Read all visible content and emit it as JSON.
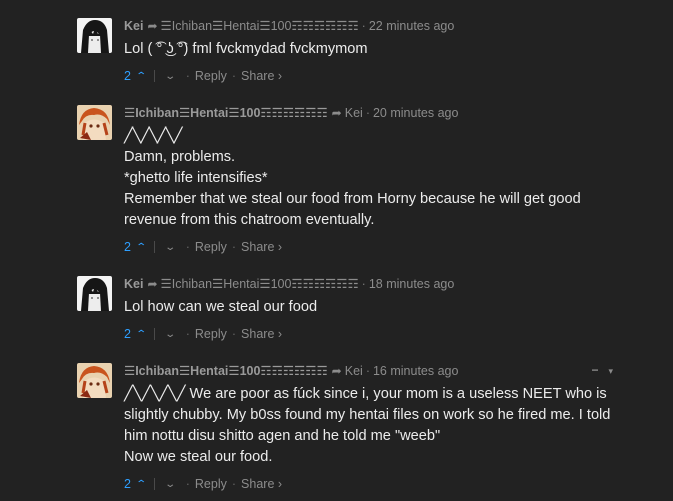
{
  "comments": [
    {
      "author": "Kei",
      "reply_to": "☰Ichiban☰Hentai☰100☶☶☶☶☶☶",
      "time": "22 minutes ago",
      "lines": [
        "Lol ( ͡° ͜ʖ ͡°) fml fvckmydad fvckmymom"
      ],
      "votes": "2",
      "reply_label": "Reply",
      "share_label": "Share ›",
      "avatar_icon": "anime-girl-dark-avatar-icon"
    },
    {
      "author": "☰Ichiban☰Hentai☰100☶☶☶☶☶☶",
      "reply_to": "Kei",
      "time": "20 minutes ago",
      "lines": [
        "╱╲╱╲╱╲╱",
        "Damn, problems.",
        "*ghetto life intensifies*",
        "Remember that we steal our food from Horny because he will get good revenue from this chatroom eventually."
      ],
      "votes": "2",
      "reply_label": "Reply",
      "share_label": "Share ›",
      "avatar_icon": "anime-girl-orange-avatar-icon"
    },
    {
      "author": "Kei",
      "reply_to": "☰Ichiban☰Hentai☰100☶☶☶☶☶☶",
      "time": "18 minutes ago",
      "lines": [
        "Lol how can we steal our food"
      ],
      "votes": "2",
      "reply_label": "Reply",
      "share_label": "Share ›",
      "avatar_icon": "anime-girl-dark-avatar-icon"
    },
    {
      "author": "☰Ichiban☰Hentai☰100☶☶☶☶☶☶",
      "reply_to": "Kei",
      "time": "16 minutes ago",
      "lines": [
        "╱╲╱╲╱╲╱ We are poor as fúck since i, your mom is a useless NEET who is slightly chubby. My b0ss found my hentai files on work so he fired me. I told him nottu disu shitto agen and he told me \"weeb\"",
        "Now we steal our food."
      ],
      "votes": "2",
      "reply_label": "Reply",
      "share_label": "Share ›",
      "avatar_icon": "anime-girl-orange-avatar-icon",
      "menu": {
        "collapse": "−",
        "options": "▾"
      }
    }
  ],
  "colors": {
    "background": "#222222",
    "accent_blue": "#2e9fff",
    "text": "#ececec",
    "muted": "#8c8c8c"
  }
}
